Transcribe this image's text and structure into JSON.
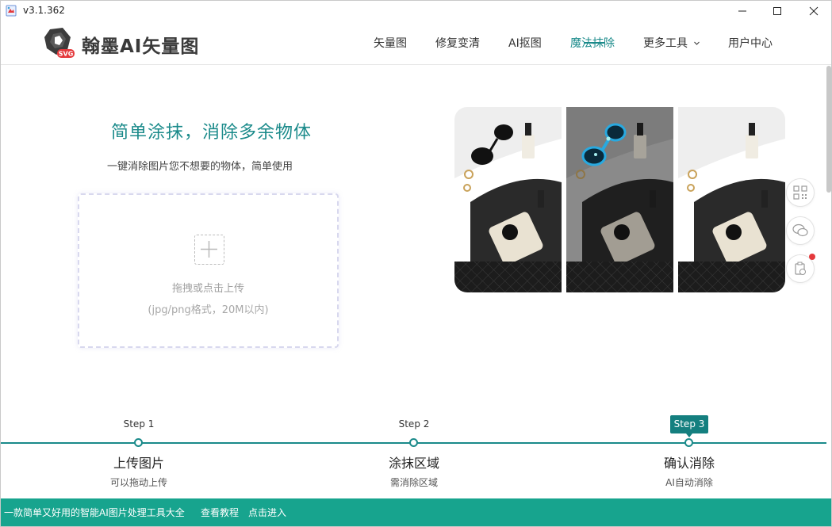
{
  "window": {
    "version": "v3.1.362",
    "controls": {
      "minimize": "minimize-icon",
      "maximize": "maximize-icon",
      "close": "close-icon"
    }
  },
  "header": {
    "brand": "翰墨AI矢量图",
    "logo_badge": "SVG",
    "nav": [
      {
        "label": "矢量图",
        "active": false
      },
      {
        "label": "修复变清",
        "active": false
      },
      {
        "label": "AI抠图",
        "active": false
      },
      {
        "label": "魔法抹除",
        "active": true
      },
      {
        "label": "更多工具",
        "active": false,
        "dropdown": true
      },
      {
        "label": "用户中心",
        "active": false
      }
    ]
  },
  "hero": {
    "title": "简单涂抹，消除多余物体",
    "subtitle": "一键消除图片您不想要的物体，简单使用",
    "upload": {
      "hint": "拖拽或点击上传",
      "formats": "(jpg/png格式，20M以内)"
    }
  },
  "side_buttons": [
    "qrcode-icon",
    "wechat-icon",
    "clipboard-icon"
  ],
  "steps": [
    {
      "step": "Step 1",
      "title": "上传图片",
      "desc": "可以拖动上传",
      "active": false
    },
    {
      "step": "Step 2",
      "title": "涂抹区域",
      "desc": "需消除区域",
      "active": false
    },
    {
      "step": "Step 3",
      "title": "确认消除",
      "desc": "AI自动消除",
      "active": true
    }
  ],
  "footer": {
    "tagline": "一款简单又好用的智能AI图片处理工具大全",
    "tutorial": "查看教程",
    "enter": "点击进入"
  },
  "colors": {
    "accent": "#1a8a8a",
    "footer": "#17a48e",
    "badge": "#147f7f",
    "dot": "#e4393c"
  }
}
